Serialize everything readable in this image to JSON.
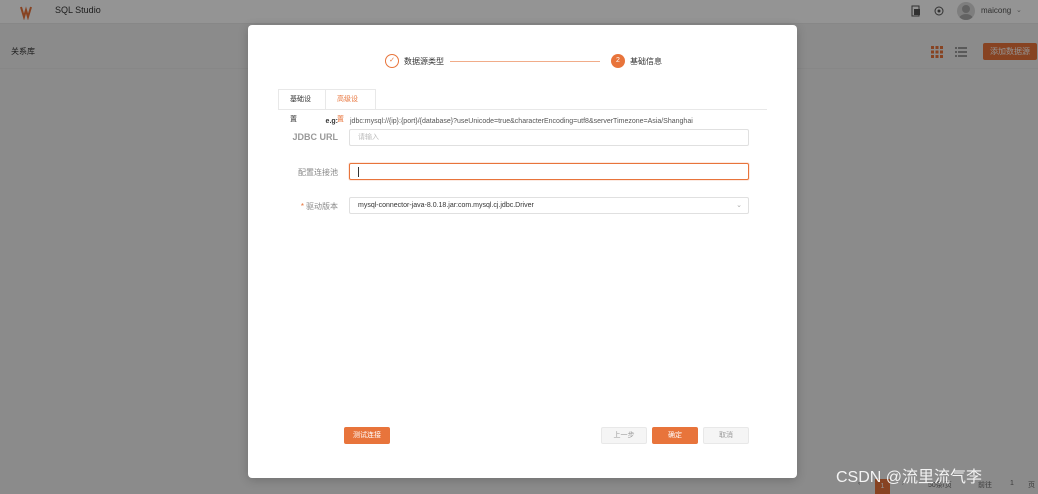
{
  "app": {
    "title": "SQL Studio",
    "user_name": "maicong"
  },
  "page": {
    "title": "关系库",
    "add_datasource_label": "添加数据源"
  },
  "pagination": {
    "active_page": "1",
    "page_size": "50条/页",
    "goto_label": "前往",
    "goto_value": "1",
    "page_suffix": "页"
  },
  "steps": [
    {
      "label": "数据源类型",
      "status": "done"
    },
    {
      "label": "基础信息",
      "number": "2",
      "status": "active"
    }
  ],
  "tabs": [
    {
      "label": "基础设置",
      "active": true
    },
    {
      "label": "高级设置",
      "active": false
    }
  ],
  "form": {
    "eg_label": "e.g:",
    "eg_text": "jdbc:mysql://{ip}:{port}/{database}?useUnicode=true&characterEncoding=utf8&serverTimezone=Asia/Shanghai",
    "jdbc_url_label": "JDBC URL",
    "jdbc_url_placeholder": "请输入",
    "pool_label": "配置连接池",
    "pool_value": "",
    "driver_label": "驱动版本",
    "driver_value": "mysql-connector-java-8.0.18.jar:com.mysql.cj.jdbc.Driver"
  },
  "buttons": {
    "test_connection": "测试连接",
    "prev": "上一步",
    "ok": "确定",
    "cancel": "取消"
  },
  "watermark": "CSDN @流里流气李",
  "colors": {
    "accent": "#e8743b"
  },
  "icons": [
    "logo-icon",
    "file-icon",
    "settings-icon",
    "avatar-icon",
    "grid-view-icon",
    "list-view-icon",
    "check-icon",
    "chevron-down-icon"
  ]
}
